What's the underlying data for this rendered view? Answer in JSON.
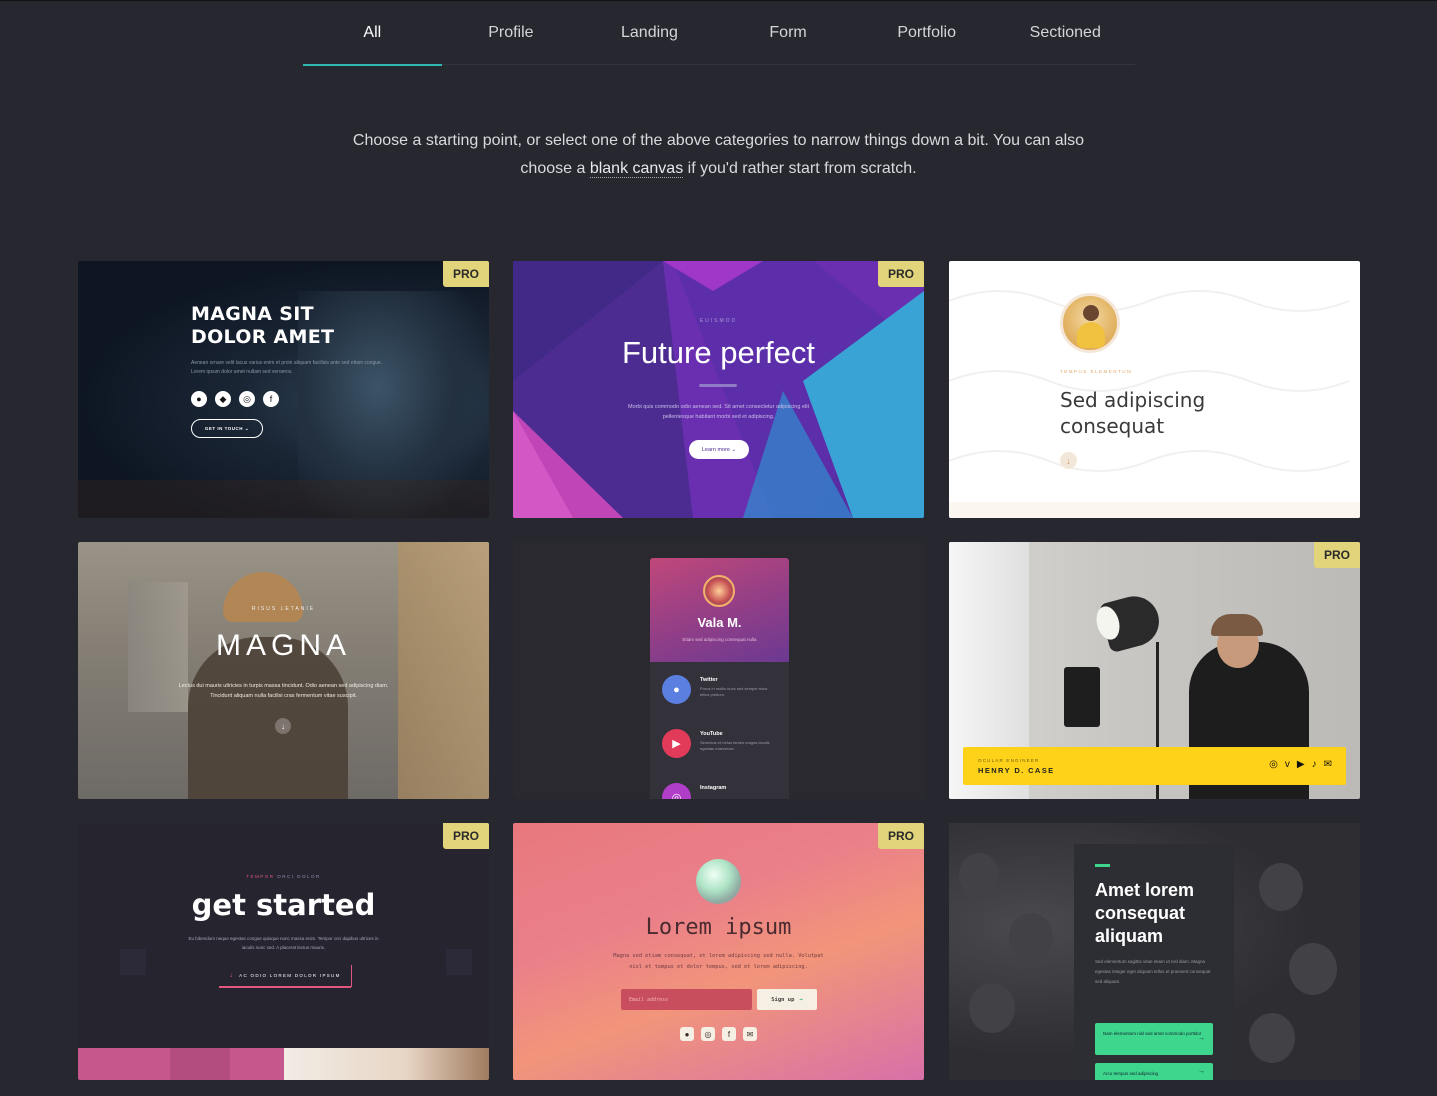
{
  "tabs": [
    {
      "label": "All",
      "active": true
    },
    {
      "label": "Profile",
      "active": false
    },
    {
      "label": "Landing",
      "active": false
    },
    {
      "label": "Form",
      "active": false
    },
    {
      "label": "Portfolio",
      "active": false
    },
    {
      "label": "Sectioned",
      "active": false
    }
  ],
  "intro": {
    "text_before": "Choose a starting point, or select one of the above categories to narrow things down a bit. You can also choose a ",
    "link": "blank canvas",
    "text_after": " if you'd rather start from scratch."
  },
  "pro_label": "PRO",
  "colors": {
    "accent": "#2fb7b0",
    "background": "#27272f",
    "pro_badge": "#e2d47a"
  },
  "templates": [
    {
      "pro": true,
      "heading": "MAGNA SIT\nDOLOR AMET",
      "body": "Aenean ornare velit lacus varius enim et proin aliquam facilisis ante sed etiam congue. Lorem ipsum dolor amet nullam sed veroeros.",
      "icons": [
        "twitter-icon",
        "discord-icon",
        "instagram-icon",
        "facebook-icon"
      ],
      "button": "GET IN TOUCH"
    },
    {
      "pro": true,
      "kicker": "EUISMOD",
      "heading": "Future perfect",
      "body": "Morbi quis commodo odio aenean sed. Sit amet consectetur adipiscing elit pellentesque habitant morbi sed et adipiscing.",
      "button": "Learn more"
    },
    {
      "pro": false,
      "kicker": "TEMPUS ELEMENTUM",
      "heading": "Sed adipiscing\nconsequat"
    },
    {
      "pro": false,
      "kicker": "RISUS LETANIE",
      "heading": "MAGNA",
      "body": "Lectus dui mauris ultricies in turpis massa tincidunt. Odio aenean sed adipiscing diam. Tincidunt aliquam nulla facilisi cras fermentum vitae suscipit."
    },
    {
      "pro": false,
      "name": "Vala M.",
      "subtitle": "Etiam sed adipiscing consequat nulla",
      "links": [
        {
          "title": "Twitter",
          "desc": "Purus in mollis nunc sed semper risus tellus pretium."
        },
        {
          "title": "YouTube",
          "desc": "Senectus et netus fames magna iaculis egestas maecenas."
        },
        {
          "title": "Instagram",
          "desc": ""
        }
      ]
    },
    {
      "pro": true,
      "kicker": "OCULAR ENGINEER",
      "name": "HENRY D. CASE",
      "icons": [
        "instagram-icon",
        "vimeo-icon",
        "youtube-icon",
        "tiktok-icon",
        "email-icon"
      ]
    },
    {
      "pro": true,
      "kicker_accent": "TEMPOR",
      "kicker_rest": " ORCI DOLOR",
      "heading": "get started",
      "body": "Eu bibendum neque egestas congue quisque nunc massa enim. Tempor orci dapibus ultrices in iaculis nunc sed. A placerat lectus mauris.",
      "button": "AC ODIO LOREM DOLOR IPSUM"
    },
    {
      "pro": true,
      "heading": "Lorem ipsum",
      "body": "Magna sed etiam consequat, et lorem adipiscing sed nulla. Volutpat nisl et tempus et dolor tempus, sed et lorem adipiscing.",
      "input_placeholder": "Email address",
      "button": "Sign up"
    },
    {
      "pro": false,
      "heading": "Amet lorem consequat aliquam",
      "body": "Sed elementum sagittis vitae etiam ut nisl diam. Magna egestas integer eget aliquam tellus et praesent consequat sed aliquam.",
      "button1": "Nam elementum nisl sed amet commodo porttitor",
      "button2": "Arcu tempus sed adipiscing"
    }
  ]
}
